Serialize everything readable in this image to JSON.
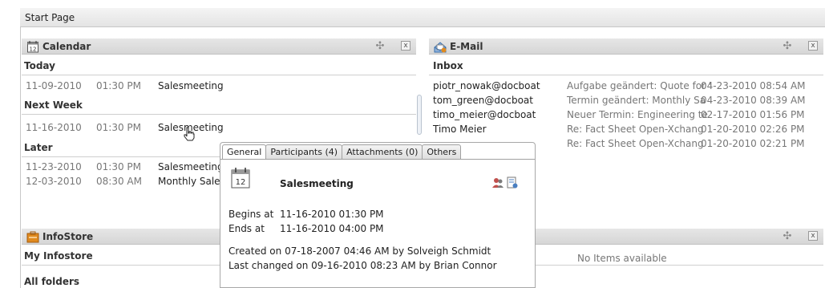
{
  "start_tab": {
    "label": "Start Page"
  },
  "calendar": {
    "title": "Calendar",
    "icon": "calendar-icon",
    "icon_number": "12",
    "sections": [
      {
        "heading": "Today",
        "items": [
          {
            "date": "11-09-2010",
            "time": "01:30 PM",
            "title": "Salesmeeting"
          }
        ]
      },
      {
        "heading": "Next Week",
        "items": [
          {
            "date": "11-16-2010",
            "time": "01:30 PM",
            "title": "Salesmeeting"
          }
        ]
      },
      {
        "heading": "Later",
        "items": [
          {
            "date": "11-23-2010",
            "time": "01:30 PM",
            "title": "Salesmeeting"
          },
          {
            "date": "12-03-2010",
            "time": "08:30 AM",
            "title": "Monthly Sales"
          }
        ]
      }
    ]
  },
  "email": {
    "title": "E-Mail",
    "icon": "mail-icon",
    "inbox_label": "Inbox",
    "messages": [
      {
        "from": "piotr_nowak@docboat",
        "subject": "Aufgabe geändert: Quote for '",
        "date": "04-23-2010 08:54 AM"
      },
      {
        "from": "tom_green@docboat",
        "subject": "Termin geändert: Monthly Sa",
        "date": "04-23-2010 08:39 AM"
      },
      {
        "from": "timo_meier@docboat",
        "subject": "Neuer Termin: Engineering te",
        "date": "02-17-2010 01:56 PM"
      },
      {
        "from": "Timo Meier",
        "subject": "Re: Fact Sheet Open-Xchang",
        "date": "01-20-2010 02:26 PM"
      },
      {
        "from": "",
        "subject": "Re: Fact Sheet Open-Xchang",
        "date": "01-20-2010 02:21 PM"
      }
    ]
  },
  "infostore": {
    "title": "InfoStore",
    "icon": "infostore-icon",
    "my_infostore": "My Infostore",
    "all_folders": "All folders"
  },
  "right_lower": {
    "empty_text": "No Items available"
  },
  "popup": {
    "tabs": [
      "General",
      "Participants (4)",
      "Attachments (0)",
      "Others"
    ],
    "title": "Salesmeeting",
    "begins_label": "Begins at",
    "begins_value": "11-16-2010 01:30 PM",
    "ends_label": "Ends at",
    "ends_value": "11-16-2010 04:00 PM",
    "created": "Created on 07-18-2007 04:46 AM by Solveigh Schmidt",
    "changed": "Last changed on 09-16-2010 08:23 AM by Brian Connor"
  },
  "colors": {
    "header_bg": "#dcdcdc",
    "link_blue": "#2b63b6",
    "accent_orange": "#e08a1e"
  }
}
